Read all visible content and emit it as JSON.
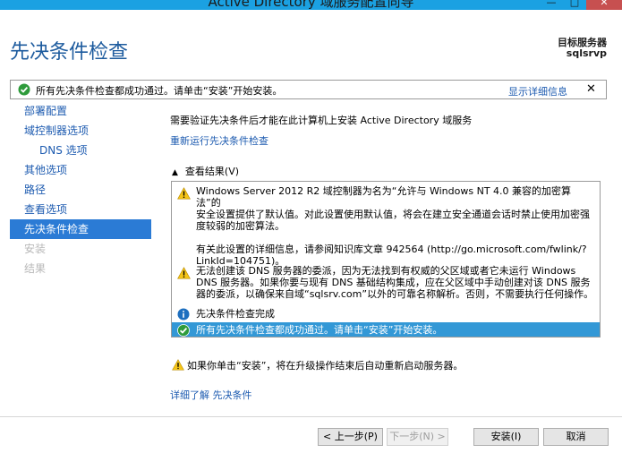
{
  "window": {
    "title": "Active Directory 域服务配置向导",
    "minimize_glyph": "—",
    "maximize_glyph": "□",
    "close_glyph": "✕"
  },
  "header": {
    "page_title": "先决条件检查",
    "target_label": "目标服务器",
    "target_value": "sqlsrvp"
  },
  "notification": {
    "message": "所有先决条件检查都成功通过。请单击“安装”开始安装。",
    "show_details": "显示详细信息",
    "close_glyph": "✕"
  },
  "nav": {
    "items": [
      {
        "label": "部署配置",
        "state": "normal"
      },
      {
        "label": "域控制器选项",
        "state": "normal"
      },
      {
        "label": "DNS 选项",
        "state": "sub"
      },
      {
        "label": "其他选项",
        "state": "normal"
      },
      {
        "label": "路径",
        "state": "normal"
      },
      {
        "label": "查看选项",
        "state": "normal"
      },
      {
        "label": "先决条件检查",
        "state": "active"
      },
      {
        "label": "安装",
        "state": "disabled"
      },
      {
        "label": "结果",
        "state": "disabled"
      }
    ]
  },
  "content": {
    "intro": "需要验证先决条件后才能在此计算机上安装 Active Directory 域服务",
    "rerun_link": "重新运行先决条件检查",
    "results_toggle": "查看结果(V)",
    "results": [
      {
        "type": "warning",
        "lines": [
          "Windows Server 2012 R2 域控制器为名为“允许与 Windows NT 4.0 兼容的加密算法”的",
          "安全设置提供了默认值。对此设置使用默认值，将会在建立安全通道会话时禁止使用加密强",
          "度较弱的加密算法。",
          "",
          "有关此设置的详细信息，请参阅知识库文章 942564 (http://go.microsoft.com/fwlink/?",
          "LinkId=104751)。"
        ]
      },
      {
        "type": "warning",
        "lines": [
          "无法创建该 DNS 服务器的委派，因为无法找到有权威的父区域或者它未运行 Windows",
          "DNS 服务器。如果你要与现有 DNS 基础结构集成，应在父区域中手动创建对该 DNS 服务",
          "器的委派，以确保来自域“sqlsrv.com”以外的可靠名称解析。否则，不需要执行任何操作。"
        ]
      },
      {
        "type": "info",
        "lines": [
          "先决条件检查完成"
        ]
      },
      {
        "type": "success",
        "lines": [
          "所有先决条件检查都成功通过。请单击“安装”开始安装。"
        ]
      }
    ],
    "restart_warning": "如果你单击“安装”，将在升级操作结束后自动重新启动服务器。",
    "more_info_link": "详细了解 先决条件"
  },
  "buttons": {
    "previous": "< 上一步(P)",
    "next": "下一步(N) >",
    "install": "安装(I)",
    "cancel": "取消"
  },
  "colors": {
    "accent_blue": "#2b7bd5",
    "title_blue": "#1d5b9e",
    "link_blue": "#1d5bb0",
    "success_green": "#2e9b3b",
    "warning_yellow": "#f5c518",
    "info_blue": "#1e6fbf",
    "selected_row": "#3398d6"
  }
}
